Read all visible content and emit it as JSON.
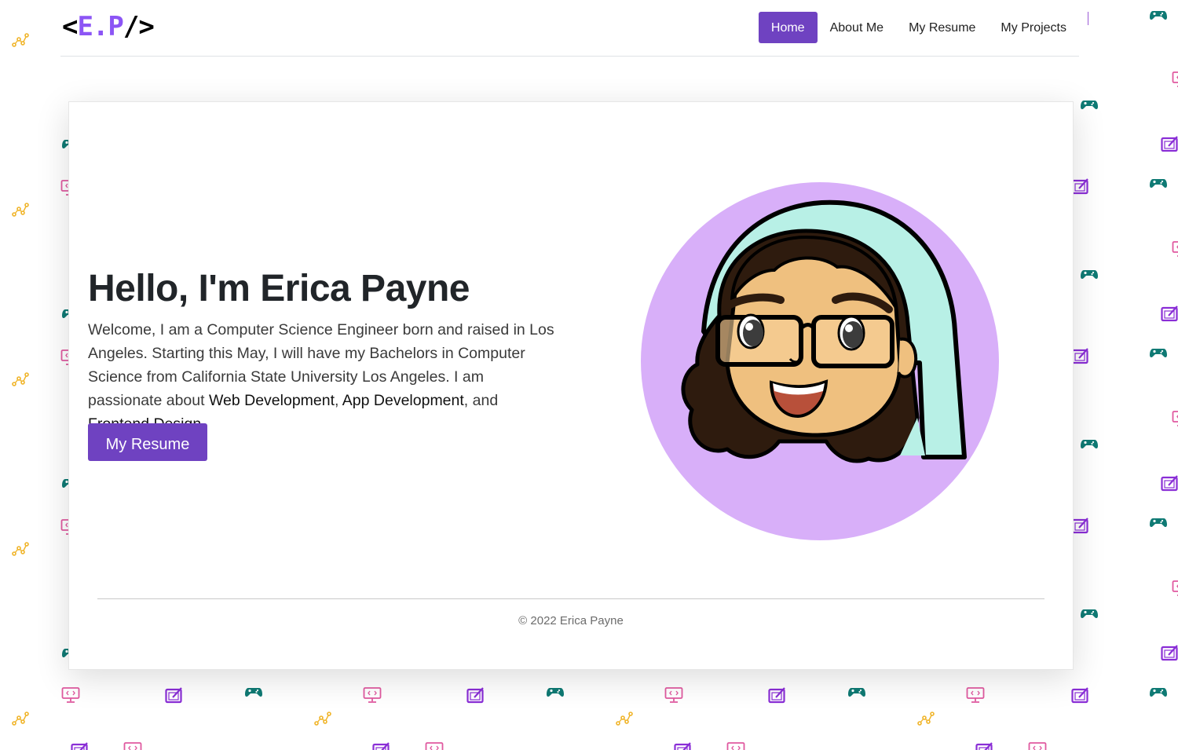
{
  "logo": {
    "open": "<",
    "initials": "E.P",
    "close": "/>"
  },
  "nav": {
    "items": [
      {
        "label": "Home",
        "active": true
      },
      {
        "label": "About Me",
        "active": false
      },
      {
        "label": "My Resume",
        "active": false
      },
      {
        "label": "My Projects",
        "active": false
      }
    ]
  },
  "hero": {
    "title": "Hello, I'm Erica Payne",
    "intro": "Welcome, I am a Computer Science Engineer born and raised in Los Angeles. Starting this May, I will have my Bachelors in Computer Science from California State University Los Angeles. I am passionate about ",
    "skill_1": "Web Development",
    "sep_1": ", ",
    "skill_2": "App Development",
    "sep_2": ", and ",
    "skill_3": "Frontend Design",
    "end": ".",
    "button_label": "My Resume"
  },
  "footer": {
    "copyright": "© 2022 Erica Payne"
  },
  "colors": {
    "accent": "#6f42c1",
    "logo_accent": "#8c55f5",
    "avatar_bg": "#d8aff9",
    "icon_gamepad": "#0f7a74",
    "icon_monitor": "#e05aa0",
    "icon_tablet": "#8a2ed6",
    "icon_chart": "#f0b429"
  },
  "background_icons": [
    "gamepad-icon",
    "monitor-code-icon",
    "drawing-tablet-icon",
    "chart-icon"
  ]
}
